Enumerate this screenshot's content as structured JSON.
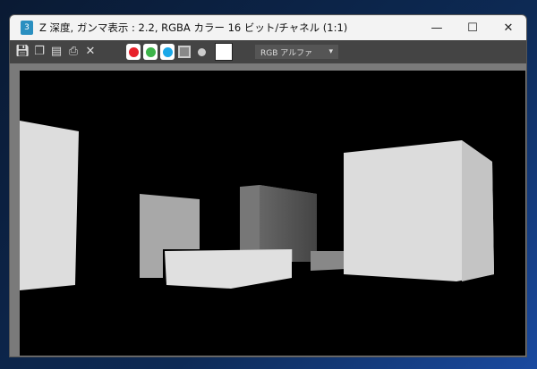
{
  "window": {
    "title": "Z 深度, ガンマ表示 : 2.2, RGBA カラー 16 ビット/チャネル (1:1)",
    "icon_label": "3"
  },
  "controls": {
    "minimize": "—",
    "maximize": "☐",
    "close": "✕"
  },
  "toolbar": {
    "channel_select": "RGB アルファ",
    "colors": {
      "red": "#e8202a",
      "green": "#3cb44a",
      "blue": "#1aa8e8"
    }
  }
}
